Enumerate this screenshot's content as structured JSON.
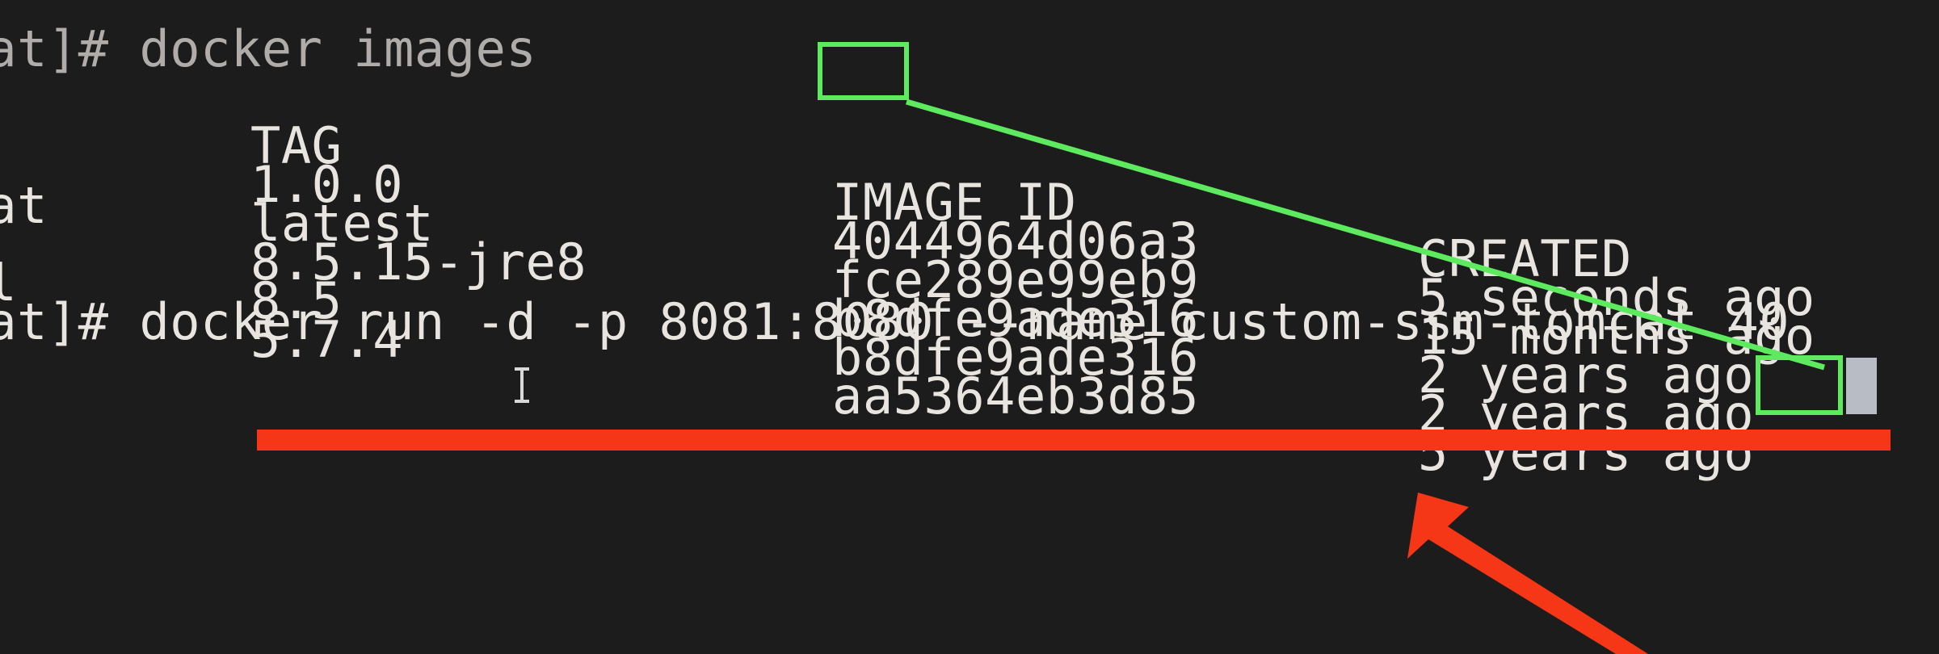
{
  "terminal": {
    "background_color": "#1c1c1c",
    "foreground_color": "#e8e4e0",
    "truncated_top_line": "tomcat]# docker images",
    "header": {
      "repository": "",
      "tag": "TAG",
      "image_id": "IMAGE ID",
      "created": "CREATED"
    },
    "rows": [
      {
        "repository": "",
        "tag": "1.0.0",
        "image_id": "4044964d06a3",
        "created": "5 seconds ago"
      },
      {
        "repository": "",
        "tag": "latest",
        "image_id": "fce289e99eb9",
        "created": "15 months ago"
      },
      {
        "repository": "tomcat",
        "tag": "8.5.15-jre8",
        "image_id": "b8dfe9ade316",
        "created": "2 years ago"
      },
      {
        "repository": "",
        "tag": "8.5",
        "image_id": "b8dfe9ade316",
        "created": "2 years ago"
      },
      {
        "repository": "mysql",
        "tag": "5.7.4",
        "image_id": "aa5364eb3d85",
        "created": "5 years ago"
      }
    ],
    "prompt": {
      "text": "tomcat]# ",
      "command": "docker run -d -p 8081:8080 --name custom-ssm-tomcat ",
      "typed_argument": "40",
      "caret": "block-caret"
    }
  },
  "annotations": {
    "green_color": "#5eea5e",
    "red_color": "#f53617",
    "highlight_source_label": "40",
    "highlight_target_label": "40",
    "connector_description": "green line from image-id prefix to typed argument",
    "underline_description": "red underline under docker run command",
    "arrow_description": "red arrow pointing up-left at the docker run command"
  },
  "cursors": {
    "mouse_pointer": "text-ibeam-cursor",
    "terminal_caret": "block-caret"
  }
}
